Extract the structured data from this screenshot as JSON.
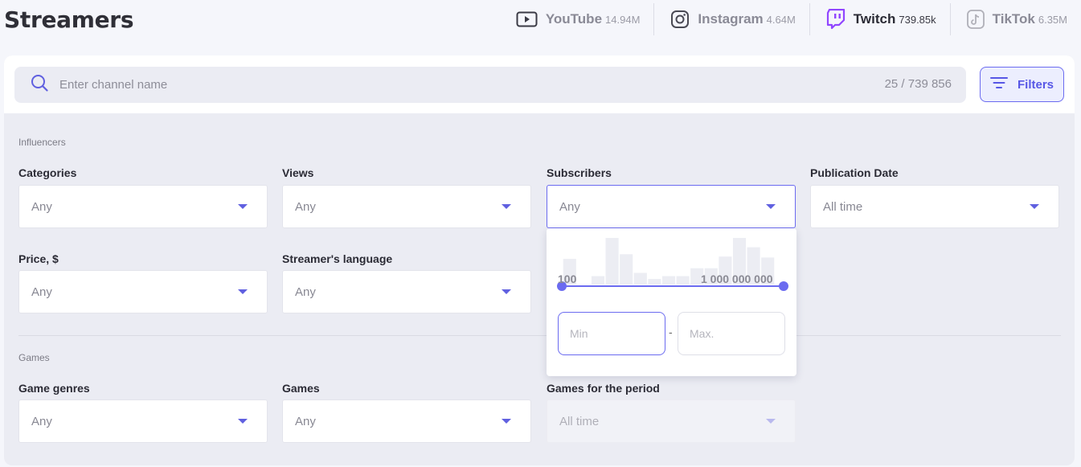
{
  "page": {
    "title": "Streamers"
  },
  "platforms": [
    {
      "name": "YouTube",
      "count": "14.94M",
      "icon": "youtube-icon",
      "active": false
    },
    {
      "name": "Instagram",
      "count": "4.64M",
      "icon": "instagram-icon",
      "active": false
    },
    {
      "name": "Twitch",
      "count": "739.85k",
      "icon": "twitch-icon",
      "active": true
    },
    {
      "name": "TikTok",
      "count": "6.35M",
      "icon": "tiktok-icon",
      "active": false
    }
  ],
  "search": {
    "placeholder": "Enter channel name",
    "counter": "25 / 739 856"
  },
  "filters_button": {
    "label": "Filters"
  },
  "influencers": {
    "section_label": "Influencers",
    "categories": {
      "label": "Categories",
      "value": "Any"
    },
    "views": {
      "label": "Views",
      "value": "Any"
    },
    "subscribers": {
      "label": "Subscribers",
      "value": "Any"
    },
    "publication_date": {
      "label": "Publication Date",
      "value": "All time"
    },
    "price": {
      "label": "Price, $",
      "value": "Any"
    },
    "language": {
      "label": "Streamer's language",
      "value": "Any"
    }
  },
  "subscribers_popover": {
    "range_min_label": "100",
    "range_max_label": "1 000 000 000",
    "min_placeholder": "Min",
    "max_placeholder": "Max.",
    "separator": "-",
    "histogram": [
      0.55,
      0,
      0.18,
      1.0,
      0.65,
      0.25,
      0.12,
      0.18,
      0.18,
      0.35,
      0.35,
      0.6,
      1.0,
      0.8,
      0.58
    ]
  },
  "games": {
    "section_label": "Games",
    "genres": {
      "label": "Game genres",
      "value": "Any"
    },
    "games": {
      "label": "Games",
      "value": "Any"
    },
    "period": {
      "label": "Games for the period",
      "value": "All time"
    }
  },
  "colors": {
    "accent": "#6b6bf0",
    "twitch": "#9146ff",
    "panel": "#ebecf3"
  }
}
